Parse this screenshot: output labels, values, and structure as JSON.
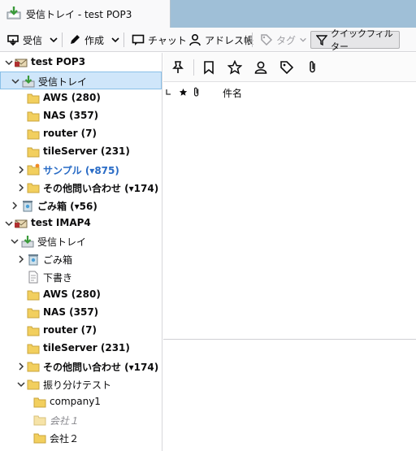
{
  "tab": {
    "title": "受信トレイ - test POP3"
  },
  "toolbar": {
    "get_mail": "受信",
    "write": "作成",
    "chat": "チャット",
    "address_book": "アドレス帳",
    "tag": "タグ",
    "quick_filter": "クイックフィルター"
  },
  "folders": [
    {
      "label": "test POP3"
    },
    {
      "label": "受信トレイ"
    },
    {
      "label": "AWS (280)"
    },
    {
      "label": "NAS (357)"
    },
    {
      "label": "router (7)"
    },
    {
      "label": "tileServer (231)"
    },
    {
      "label": "サンプル (▾875)"
    },
    {
      "label": "その他問い合わせ (▾174)"
    },
    {
      "label": "ごみ箱 (▾56)"
    },
    {
      "label": "test IMAP4"
    },
    {
      "label": "受信トレイ"
    },
    {
      "label": "ごみ箱"
    },
    {
      "label": "下書き"
    },
    {
      "label": "AWS (280)"
    },
    {
      "label": "NAS (357)"
    },
    {
      "label": "router (7)"
    },
    {
      "label": "tileServer (231)"
    },
    {
      "label": "その他問い合わせ (▾174)"
    },
    {
      "label": "振り分けテスト"
    },
    {
      "label": "company1"
    },
    {
      "label": "会社１"
    },
    {
      "label": "会社２"
    }
  ],
  "message_list": {
    "columns": {
      "subject": "件名"
    }
  },
  "colors": {
    "selected_bg": "#cfe6fa",
    "accent_blue": "#2a6cc6",
    "tabbar_bg": "#9fbfd7"
  }
}
